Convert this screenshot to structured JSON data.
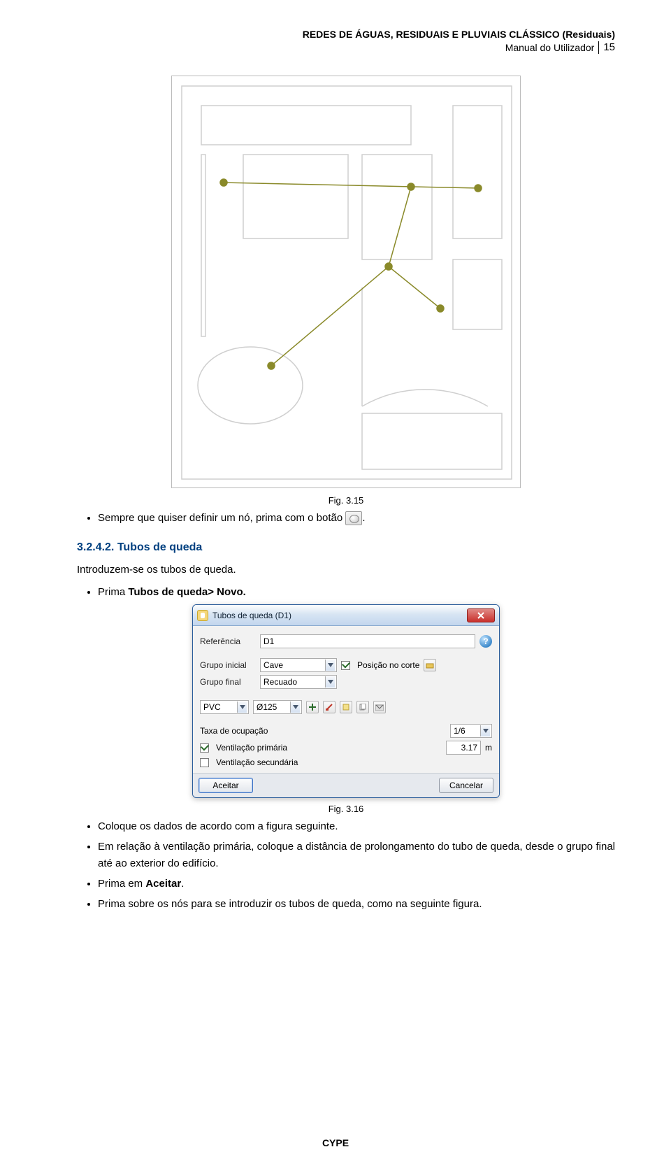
{
  "header": {
    "title_bold": "REDES DE ÁGUAS, RESIDUAIS E PLUVIAIS CLÁSSICO (Residuais)",
    "subtitle": "Manual do Utilizador",
    "page_number": "15"
  },
  "fig315": {
    "caption": "Fig. 3.15"
  },
  "bullets1": {
    "text_a": "Sempre que quiser definir um nó, prima com o botão ",
    "text_b": "."
  },
  "section": {
    "heading": "3.2.4.2. Tubos de queda"
  },
  "intro": "Introduzem-se os tubos de queda.",
  "bullets2": {
    "item1_a": "Prima ",
    "item1_b": "Tubos de queda> Novo."
  },
  "dialog": {
    "title": "Tubos de queda (D1)",
    "ref_label": "Referência",
    "ref_value": "D1",
    "grp_ini_label": "Grupo inicial",
    "grp_ini_value": "Cave",
    "grp_fin_label": "Grupo final",
    "grp_fin_value": "Recuado",
    "pos_corte": "Posição no corte",
    "mat": "PVC",
    "diam": "Ø125",
    "tax_label": "Taxa de ocupação",
    "tax_value": "1/6",
    "vent1": "Ventilação primária",
    "vent1_val": "3.17",
    "vent1_unit": "m",
    "vent2": "Ventilação secundária",
    "accept": "Aceitar",
    "cancel": "Cancelar"
  },
  "fig316": {
    "caption": "Fig. 3.16"
  },
  "bullets3": {
    "i1": "Coloque os dados de acordo com a figura seguinte.",
    "i2": "Em relação à ventilação primária, coloque a distância de prolongamento do tubo de queda, desde o grupo final até ao exterior do edifício.",
    "i3_a": "Prima em ",
    "i3_b": "Aceitar",
    "i3_c": ".",
    "i4": "Prima sobre os nós para se introduzir os tubos de queda, como na seguinte figura."
  },
  "footer": "CYPE"
}
